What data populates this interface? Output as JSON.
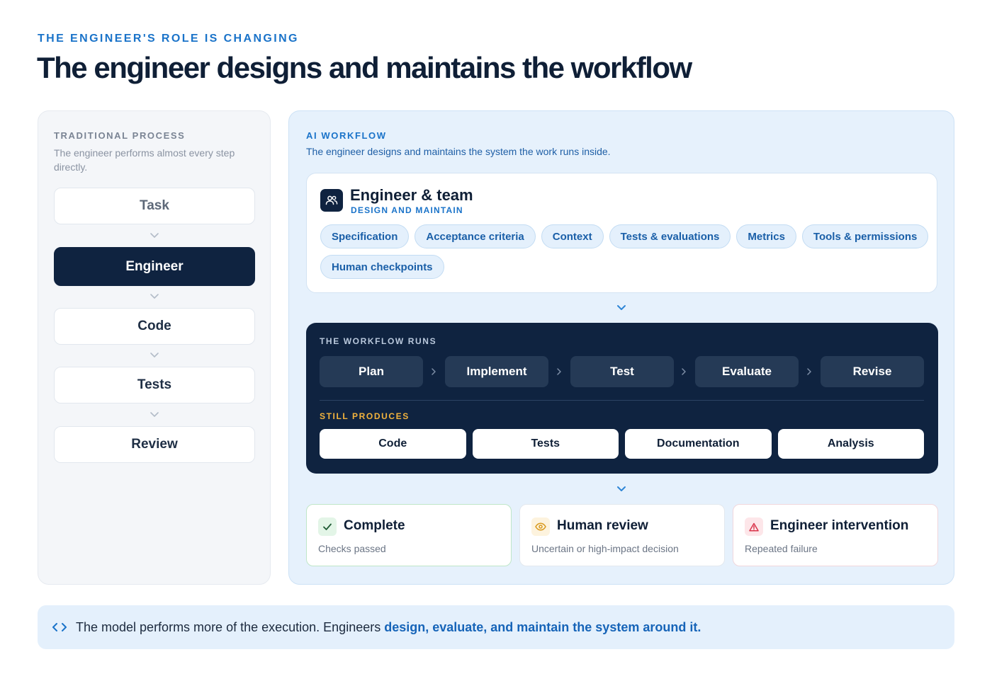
{
  "header": {
    "eyebrow": "THE ENGINEER'S ROLE IS CHANGING",
    "title": "The engineer designs and maintains the workflow"
  },
  "traditional": {
    "label": "TRADITIONAL PROCESS",
    "description": "The engineer performs almost every step directly.",
    "steps": [
      "Task",
      "Engineer",
      "Code",
      "Tests",
      "Review"
    ]
  },
  "ai_workflow": {
    "label": "AI WORKFLOW",
    "description": "The engineer designs and maintains the system the work runs inside.",
    "team": {
      "title": "Engineer & team",
      "subtitle": "DESIGN AND MAINTAIN",
      "icon": "users-icon",
      "chips": [
        "Specification",
        "Acceptance criteria",
        "Context",
        "Tests & evaluations",
        "Metrics",
        "Tools & permissions",
        "Human checkpoints"
      ]
    },
    "run": {
      "label": "THE WORKFLOW RUNS",
      "stages": [
        "Plan",
        "Implement",
        "Test",
        "Evaluate",
        "Revise"
      ],
      "produces_label": "STILL PRODUCES",
      "produces": [
        "Code",
        "Tests",
        "Documentation",
        "Analysis"
      ]
    },
    "outcomes": [
      {
        "title": "Complete",
        "description": "Checks passed",
        "icon": "check-icon",
        "color": "#1f8a3b"
      },
      {
        "title": "Human review",
        "description": "Uncertain or high-impact decision",
        "icon": "eye-icon",
        "color": "#d99a1e"
      },
      {
        "title": "Engineer intervention",
        "description": "Repeated failure",
        "icon": "warning-icon",
        "color": "#d9344a"
      }
    ]
  },
  "banner": {
    "icon": "code-icon",
    "text": "The model performs more of the execution. Engineers ",
    "emphasis": "design, evaluate, and maintain the system around it."
  },
  "colors": {
    "accent": "#1a73c9",
    "navy": "#0f2340",
    "gold": "#f2b33d",
    "light_blue": "#e6f1fc"
  }
}
